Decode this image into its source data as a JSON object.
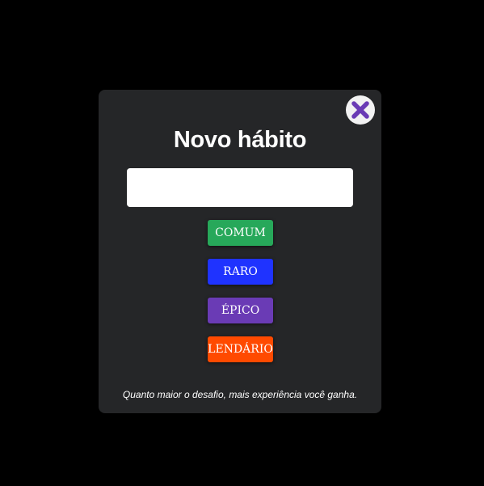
{
  "modal": {
    "title": "Novo hábito",
    "close_icon": "close-x-icon",
    "close_color": "#6a3bb5",
    "input": {
      "value": "",
      "placeholder": ""
    },
    "rarities": [
      {
        "label": "COMUM",
        "color": "#27a85a"
      },
      {
        "label": "RARO",
        "color": "#1f33ff"
      },
      {
        "label": "ÉPICO",
        "color": "#6a3bb5"
      },
      {
        "label": "LENDÁRIO",
        "color": "#ff4a00"
      }
    ],
    "footer": "Quanto maior o desafio, mais experiência você ganha."
  }
}
